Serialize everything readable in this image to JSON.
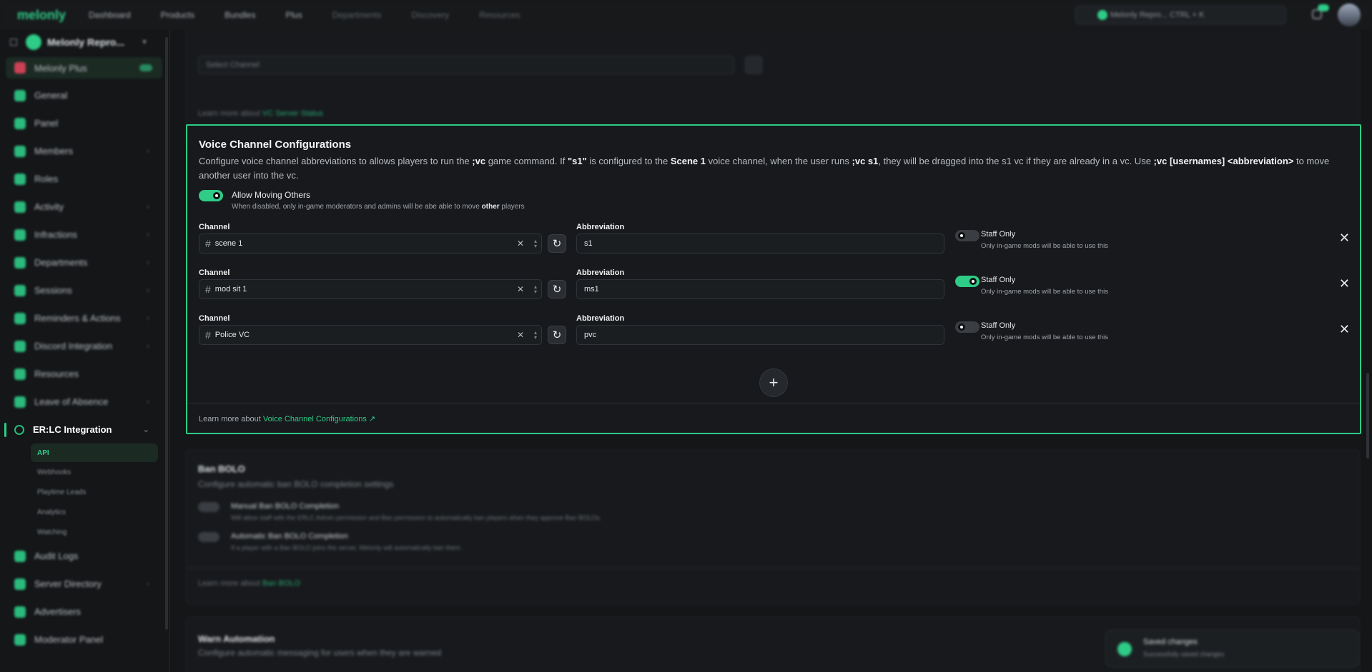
{
  "topbar": {
    "logo": "melonly",
    "nav": [
      "Dashboard",
      "Products",
      "Bundles",
      "Plus",
      "Departments",
      "Discovery",
      "Resources"
    ],
    "search_text": "Melonly Repro...   CTRL + K"
  },
  "sidebar": {
    "server_name": "Melonly Repro...",
    "plus_label": "Melonly Plus",
    "items": [
      "General",
      "Panel",
      "Members",
      "Roles",
      "Activity",
      "Infractions",
      "Departments",
      "Sessions",
      "Reminders & Actions",
      "Discord Integration",
      "Resources",
      "Leave of Absence"
    ],
    "active_item": "ER:LC Integration",
    "sub_items": [
      "API",
      "Webhooks",
      "Playtime Leads",
      "Analytics",
      "Watching"
    ],
    "bottom_items": [
      "Audit Logs",
      "Server Directory",
      "Advertisers",
      "Moderator Panel"
    ]
  },
  "top_card": {
    "select_placeholder": "Select Channel",
    "learn_prefix": "Learn more about",
    "learn_link": "VC Server Status"
  },
  "vc": {
    "title": "Voice Channel Configurations",
    "desc_1": "Configure voice channel abbreviations to allows players to run the ",
    "desc_cmd": ";vc",
    "desc_2": " game command. If ",
    "desc_s1": "\"s1\"",
    "desc_3": " is configured to the ",
    "desc_scene": "Scene 1",
    "desc_4": " voice channel, when the user runs ",
    "desc_vcs1": ";vc s1",
    "desc_5": ", they will be dragged into the s1 vc if they are already in a vc. Use ",
    "desc_usage": ";vc [usernames] <abbreviation>",
    "desc_6": " to move another user into the vc.",
    "allow_label": "Allow Moving Others",
    "allow_desc_1": "When disabled, only in-game moderators and admins will be abe able to move ",
    "allow_desc_bold": "other",
    "allow_desc_2": " players",
    "allow_on": true,
    "channel_label": "Channel",
    "abbr_label": "Abbreviation",
    "staff_label": "Staff Only",
    "staff_desc": "Only in-game mods will be able to use this",
    "rows": [
      {
        "channel": "scene 1",
        "abbr": "s1",
        "staff": false
      },
      {
        "channel": "mod sit 1",
        "abbr": "ms1",
        "staff": true
      },
      {
        "channel": "Police VC",
        "abbr": "pvc",
        "staff": false
      }
    ],
    "learn_prefix": "Learn more about",
    "learn_link": "Voice Channel Configurations",
    "accent": "#2ecc87"
  },
  "ban_card": {
    "title": "Ban BOLO",
    "desc": "Configure automatic ban BOLO completion settings",
    "opt1": "Manual Ban BOLO Completion",
    "opt1_desc": "Will allow staff with the ERLC Admin permission and Ban permission to automatically ban players when they approve Ban BOLOs.",
    "opt2": "Automatic Ban BOLO Completion",
    "opt2_desc": "If a player with a Ban BOLO joins the server, Melonly will automatically ban them.",
    "learn_prefix": "Learn more about",
    "learn_link": "Ban BOLO"
  },
  "warn_card": {
    "title": "Warn Automation",
    "desc": "Configure automatic messaging for users when they are warned"
  },
  "toast": {
    "title": "Saved changes",
    "desc": "Successfully saved changes"
  }
}
